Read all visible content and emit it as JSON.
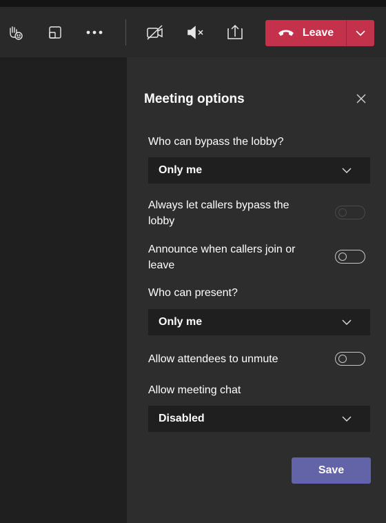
{
  "toolbar": {
    "icons": [
      "raise-hand-icon",
      "share-tray-icon",
      "more-options-icon",
      "camera-off-icon",
      "speaker-mute-icon",
      "share-content-icon"
    ],
    "leave_label": "Leave"
  },
  "meeting_options": {
    "title": "Meeting options",
    "bypass_lobby_label": "Who can bypass the lobby?",
    "bypass_lobby_value": "Only me",
    "callers_bypass_label_line1": "Always let callers bypass the",
    "callers_bypass_label_line2": "lobby",
    "callers_bypass_enabled": false,
    "announce_label_line1": "Announce when callers join or",
    "announce_label_line2": "leave",
    "announce_on": false,
    "who_can_present_label": "Who can present?",
    "who_can_present_value": "Only me",
    "unmute_label": "Allow attendees to unmute",
    "unmute_on": false,
    "chat_label": "Allow meeting chat",
    "chat_value": "Disabled",
    "save_label": "Save"
  },
  "colors": {
    "leave": "#c4314b",
    "save": "#6264a7",
    "panel": "#2d2d2d",
    "select": "#1f1f1f"
  }
}
